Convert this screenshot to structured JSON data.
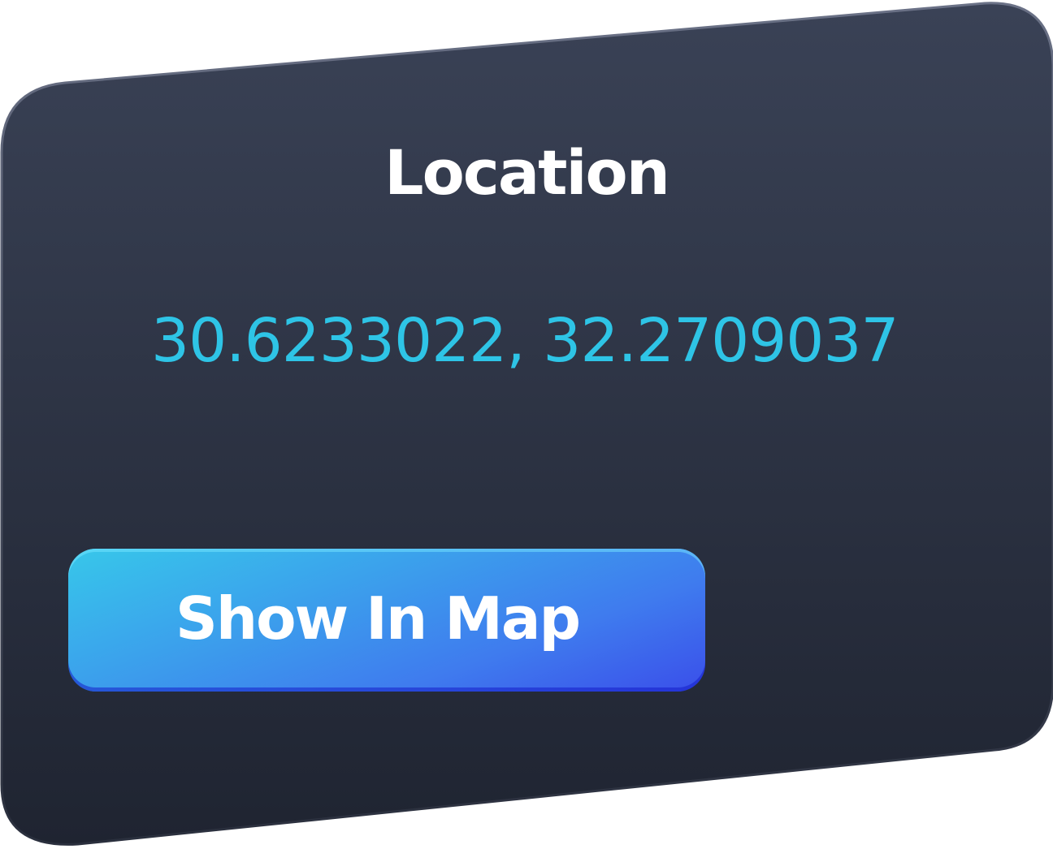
{
  "card": {
    "title": "Location",
    "coordinates": "30.6233022, 32.2709037"
  },
  "button": {
    "label": "Show In Map"
  },
  "colors": {
    "card_top": "#3a4256",
    "card_bottom": "#1f2431",
    "coordinate_text": "#2ec4e6",
    "button_start": "#37c7ea",
    "button_end": "#3a4fea"
  }
}
